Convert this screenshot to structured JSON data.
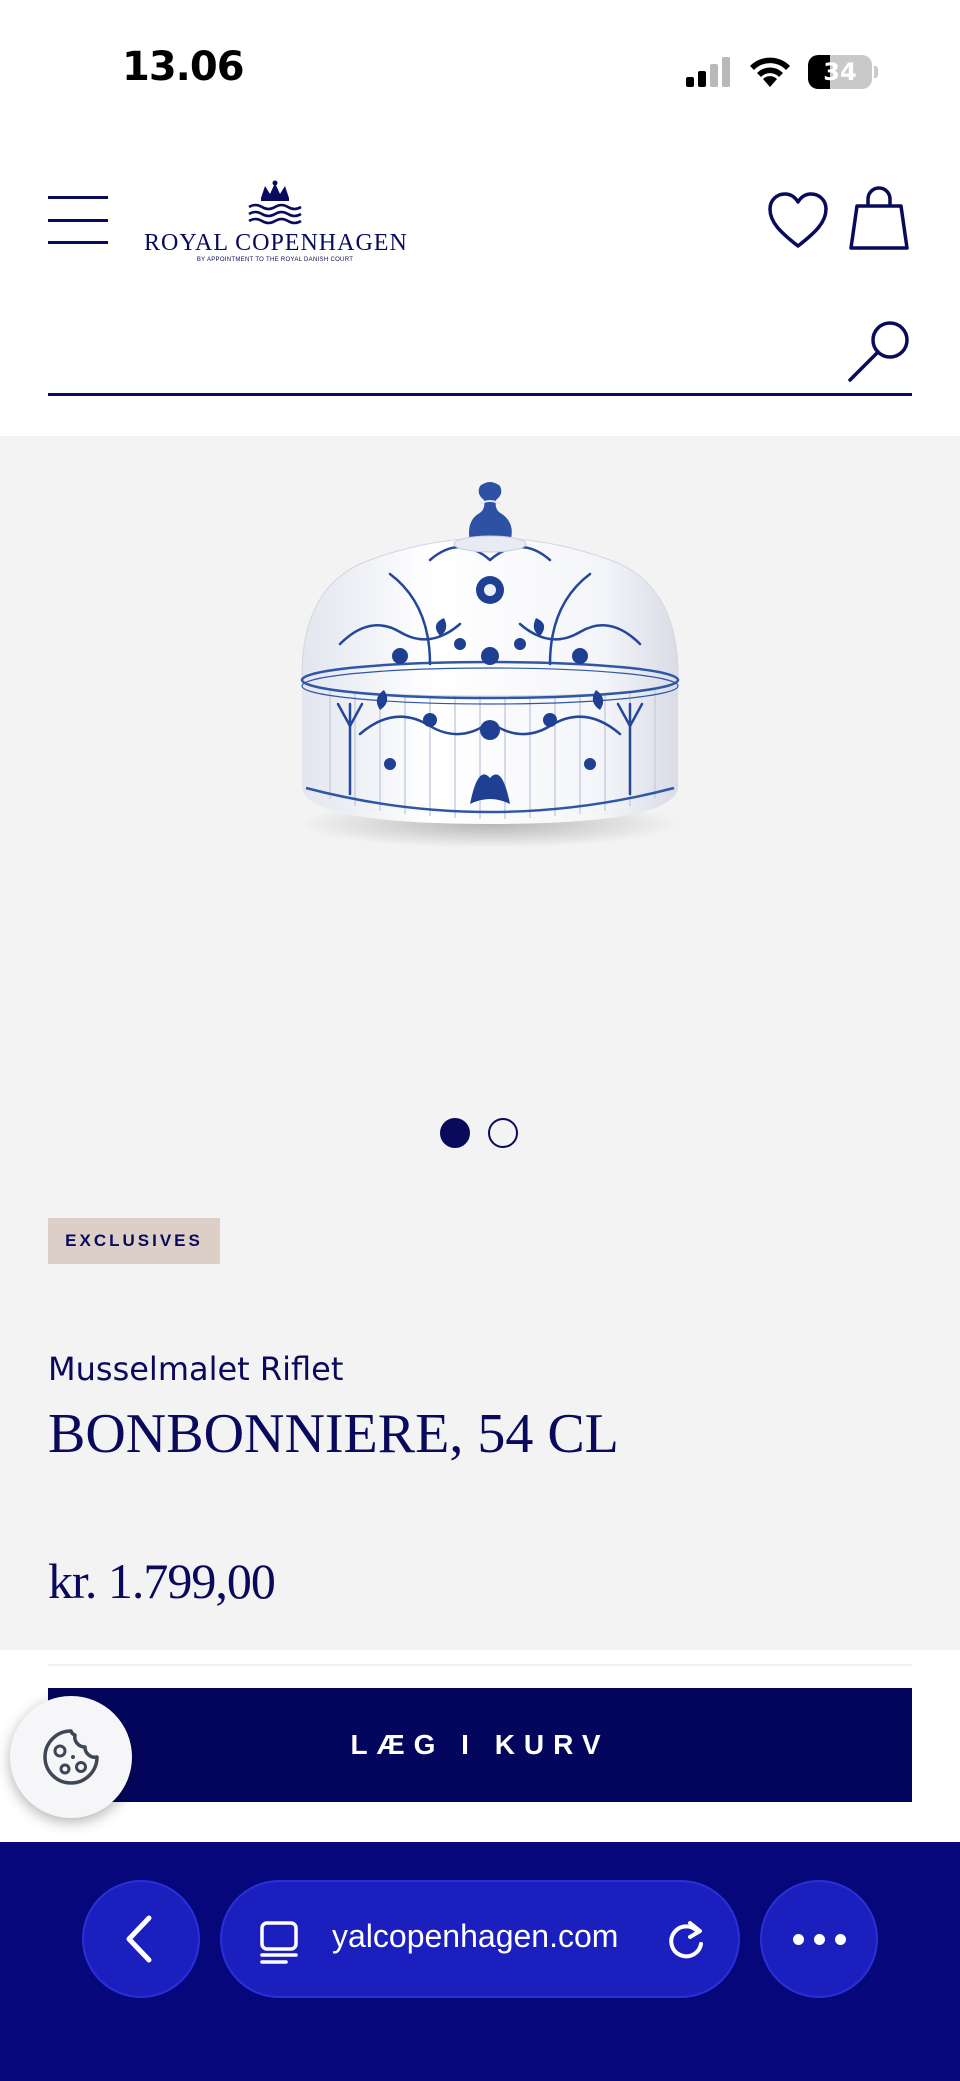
{
  "status_bar": {
    "time": "13.06",
    "battery_level": "34",
    "battery_fraction": 0.34
  },
  "header": {
    "logo_name": "ROYAL COPENHAGEN",
    "logo_tagline": "BY APPOINTMENT TO THE ROYAL DANISH COURT",
    "search": {
      "value": "",
      "placeholder": ""
    }
  },
  "product": {
    "carousel": {
      "total": 2,
      "active_index": 0
    },
    "badge": "EXCLUSIVES",
    "collection": "Musselmalet Riflet",
    "title": "BONBONNIERE, 54 CL",
    "price": "kr. 1.799,00"
  },
  "cart": {
    "add_to_cart_label": "LÆG I KURV"
  },
  "browser": {
    "url": "yalcopenhagen.com"
  },
  "colors": {
    "brand_navy": "#0a0a5c",
    "button_navy": "#04065e",
    "browser_bar": "#05077a",
    "product_bg": "#f3f3f3",
    "badge_bg": "#dccfc8"
  }
}
